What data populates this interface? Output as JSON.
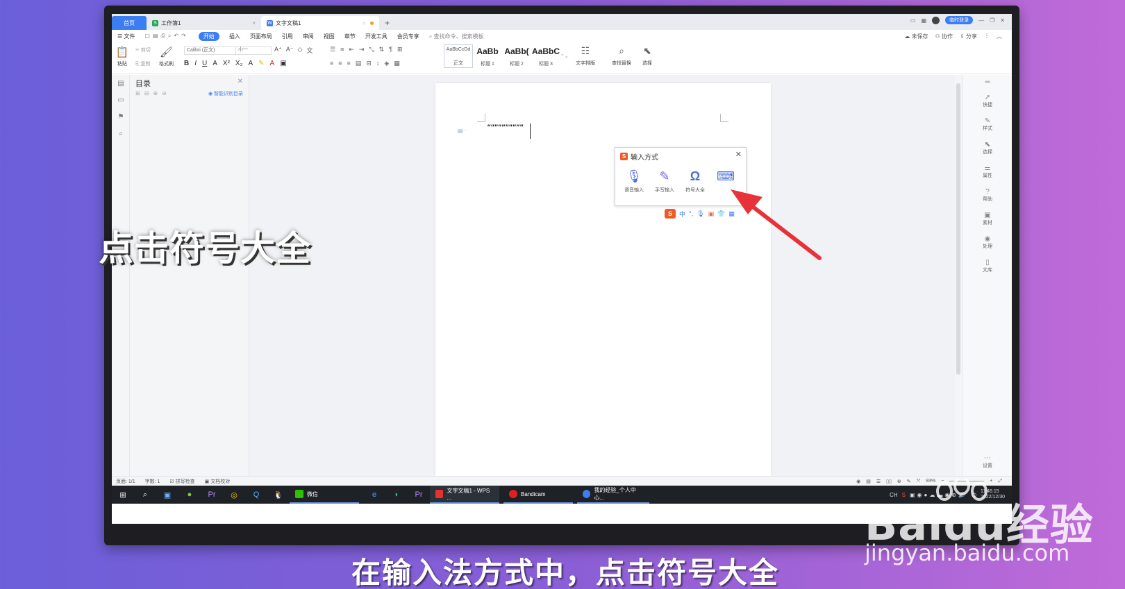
{
  "tabs": {
    "home": "首页",
    "sheet": "工作簿1",
    "doc": "文字文稿1",
    "login": "临时登录"
  },
  "menu": {
    "file": "文件",
    "items": [
      "开始",
      "插入",
      "页面布局",
      "引用",
      "审阅",
      "视图",
      "章节",
      "开发工具",
      "会员专享"
    ],
    "search": "查找命令、搜索模板",
    "unsaved": "未保存",
    "collab": "协作",
    "share": "分享"
  },
  "ribbon": {
    "paste": "粘贴",
    "cut": "剪切",
    "copy": "复制",
    "format_painter": "格式刷",
    "font": "Calibri (正文)",
    "size": "小一",
    "styles": [
      {
        "sample": "AaBbCcDd",
        "name": "正文"
      },
      {
        "sample": "AaBb",
        "name": "标题 1"
      },
      {
        "sample": "AaBb(",
        "name": "标题 2"
      },
      {
        "sample": "AaBbC",
        "name": "标题 3"
      }
    ],
    "text_layout": "文字排版",
    "find_replace": "查找替换",
    "select": "选择"
  },
  "outline": {
    "title": "目录",
    "smart": "智能识别目录"
  },
  "document": {
    "text": "\"\"\"\"\"\"\"\"\"\""
  },
  "ime_popup": {
    "title": "输入方式",
    "options": [
      {
        "label": "语音输入",
        "icon": "microphone-icon"
      },
      {
        "label": "手写输入",
        "icon": "pen-icon"
      },
      {
        "label": "符号大全",
        "icon": "omega-icon"
      },
      {
        "label": "",
        "icon": "keyboard-icon"
      }
    ],
    "bar_lang": "中"
  },
  "right_tools": [
    "快捷",
    "样式",
    "选择",
    "属性",
    "帮助",
    "素材",
    "处理",
    "文库"
  ],
  "right_bottom": "设置",
  "status": {
    "page": "页面: 1/1",
    "words": "字数: 1",
    "spell": "拼写检查",
    "proof": "文档校对",
    "zoom": "93%"
  },
  "taskbar": {
    "wechat": "微信",
    "wps": "文字文稿1 - WPS ...",
    "bandicam": "Bandicam",
    "browser": "我的经验_个人中心...",
    "ime_indicator": "CH",
    "time": "11:46:15",
    "date": "2022/12/30"
  },
  "captions": {
    "side": "点击符号大全",
    "bottom": "在输入法方式中，点击符号大全"
  },
  "watermark": {
    "brand": "Baidu经验",
    "url": "jingyan.baidu.com"
  },
  "colors": {
    "accent": "#3c7df2",
    "arrow": "#e8323a",
    "sogou": "#ef5a24"
  }
}
